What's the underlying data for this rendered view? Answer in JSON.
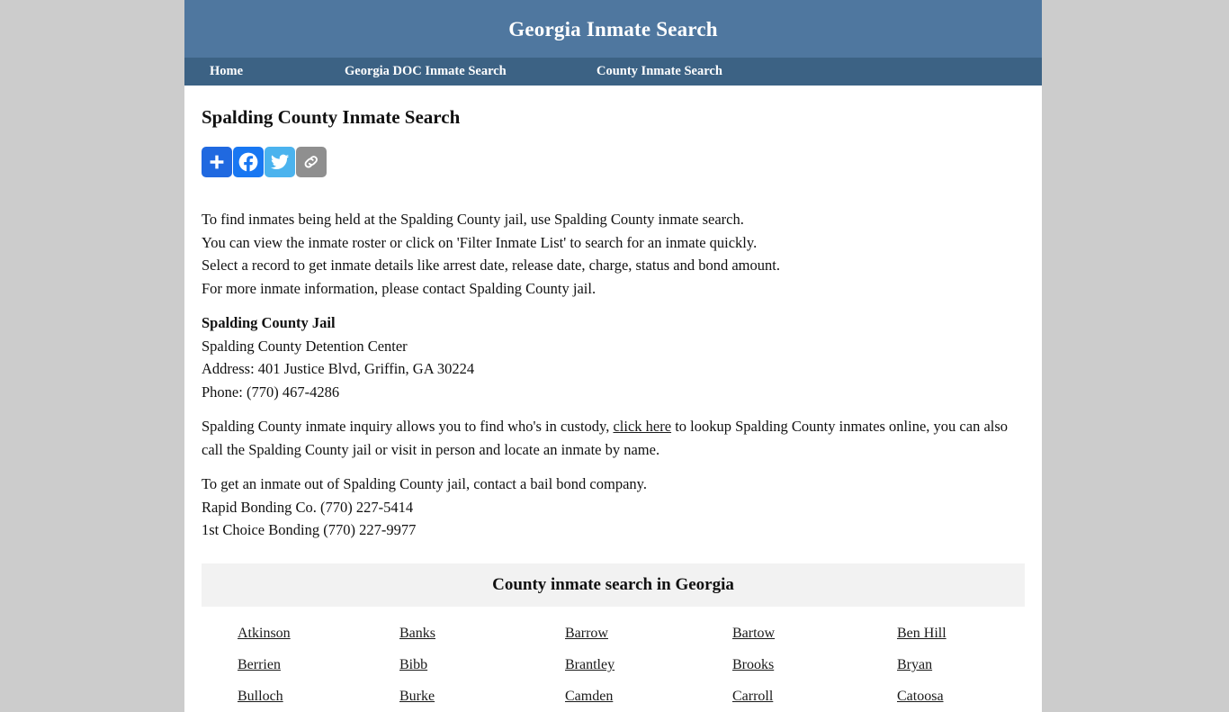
{
  "site": {
    "title": "Georgia Inmate Search",
    "header_bg": "#4f779f",
    "nav_bg": "#3c6284",
    "page_bg": "#cccccc"
  },
  "nav": {
    "items": [
      {
        "label": "Home"
      },
      {
        "label": "Georgia DOC Inmate Search"
      },
      {
        "label": "County Inmate Search"
      }
    ]
  },
  "main": {
    "page_title": "Spalding County Inmate Search",
    "share": {
      "buttons": [
        {
          "name": "addthis-share-button",
          "icon": "plus-icon",
          "color": "#2069e0"
        },
        {
          "name": "facebook-share-button",
          "icon": "facebook-icon",
          "color": "#1877f2"
        },
        {
          "name": "twitter-share-button",
          "icon": "twitter-bird-icon",
          "color": "#4bb3ee"
        },
        {
          "name": "copy-link-button",
          "icon": "chain-link-icon",
          "color": "#8f8f8f"
        }
      ]
    },
    "intro_lines": [
      "To find inmates being held at the Spalding County jail, use Spalding County inmate search.",
      "You can view the inmate roster or click on 'Filter Inmate List' to search for an inmate quickly.",
      "Select a record to get inmate details like arrest date, release date, charge, status and bond amount.",
      "For more inmate information, please contact Spalding County jail."
    ],
    "jail": {
      "name": "Spalding County Jail",
      "facility": "Spalding County Detention Center",
      "address": "Address: 401 Justice Blvd, Griffin, GA 30224",
      "phone": "Phone: (770) 467-4286"
    },
    "inquiry": {
      "before_link": "Spalding County inmate inquiry allows you to find who's in custody, ",
      "link_text": "click here",
      "after_link": " to lookup Spalding County inmates online, you can also call the Spalding County jail or visit in person and locate an inmate by name."
    },
    "bail": {
      "intro": "To get an inmate out of Spalding County jail, contact a bail bond company.",
      "companies": [
        "Rapid Bonding Co. (770) 227-5414",
        "1st Choice Bonding (770) 227-9977"
      ]
    }
  },
  "counties": {
    "heading": "County inmate search in Georgia",
    "rows": [
      [
        "Atkinson",
        "Banks",
        "Barrow",
        "Bartow",
        "Ben Hill"
      ],
      [
        "Berrien",
        "Bibb",
        "Brantley",
        "Brooks",
        "Bryan"
      ],
      [
        "Bulloch",
        "Burke",
        "Camden",
        "Carroll",
        "Catoosa"
      ]
    ]
  }
}
